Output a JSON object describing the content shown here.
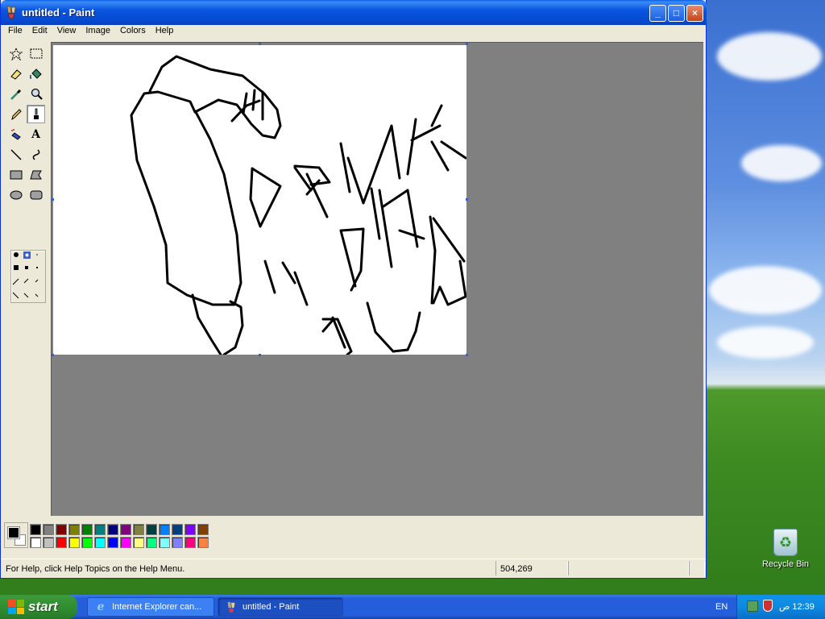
{
  "window": {
    "title": "untitled - Paint",
    "controls": {
      "minimize": "_",
      "maximize": "□",
      "close": "×"
    }
  },
  "menubar": [
    "File",
    "Edit",
    "View",
    "Image",
    "Colors",
    "Help"
  ],
  "tools": [
    {
      "name": "free-form-select",
      "icon": "star-select-icon"
    },
    {
      "name": "select",
      "icon": "rect-select-icon"
    },
    {
      "name": "eraser",
      "icon": "eraser-icon"
    },
    {
      "name": "fill",
      "icon": "paint-bucket-icon"
    },
    {
      "name": "pick-color",
      "icon": "eyedropper-icon"
    },
    {
      "name": "magnifier",
      "icon": "magnifier-icon"
    },
    {
      "name": "pencil",
      "icon": "pencil-icon"
    },
    {
      "name": "brush",
      "icon": "brush-icon",
      "selected": true
    },
    {
      "name": "airbrush",
      "icon": "airbrush-icon"
    },
    {
      "name": "text",
      "icon": "text-icon",
      "label": "A"
    },
    {
      "name": "line",
      "icon": "line-icon"
    },
    {
      "name": "curve",
      "icon": "curve-icon"
    },
    {
      "name": "rectangle",
      "icon": "rectangle-icon"
    },
    {
      "name": "polygon",
      "icon": "polygon-icon"
    },
    {
      "name": "ellipse",
      "icon": "ellipse-icon"
    },
    {
      "name": "rounded-rectangle",
      "icon": "rounded-rect-icon"
    }
  ],
  "palette": {
    "foreground": "#000000",
    "background": "#ffffff",
    "top_row": [
      "#000000",
      "#808080",
      "#800000",
      "#808000",
      "#008000",
      "#008080",
      "#000080",
      "#800080",
      "#808040",
      "#004040",
      "#0080ff",
      "#004080",
      "#8000ff",
      "#804000"
    ],
    "bottom_row": [
      "#ffffff",
      "#c0c0c0",
      "#ff0000",
      "#ffff00",
      "#00ff00",
      "#00ffff",
      "#0000ff",
      "#ff00ff",
      "#ffff80",
      "#00ff80",
      "#80ffff",
      "#8080ff",
      "#ff0080",
      "#ff8040"
    ]
  },
  "statusbar": {
    "help_text": "For Help, click Help Topics on the Help Menu.",
    "coords": "504,269"
  },
  "desktop": {
    "recycle_bin_label": "Recycle Bin"
  },
  "taskbar": {
    "start_label": "start",
    "tasks": [
      {
        "label": "Internet Explorer can...",
        "icon": "ie-icon",
        "active": false
      },
      {
        "label": "untitled - Paint",
        "icon": "paint-icon",
        "active": true
      }
    ],
    "language": "EN",
    "clock": "12:39 ص"
  }
}
